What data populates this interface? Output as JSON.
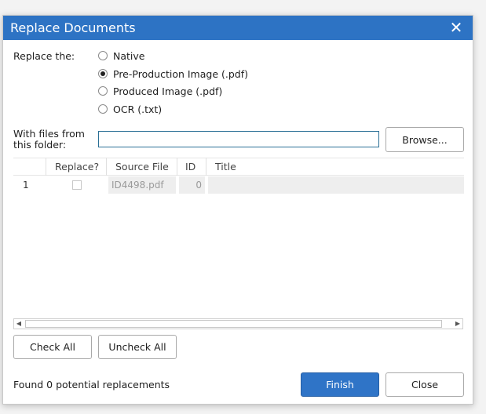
{
  "dialog": {
    "title": "Replace Documents",
    "close_glyph": "✕"
  },
  "replace": {
    "label": "Replace the:",
    "options": [
      {
        "label": "Native",
        "checked": false
      },
      {
        "label": "Pre-Production Image (.pdf)",
        "checked": true
      },
      {
        "label": "Produced Image (.pdf)",
        "checked": false
      },
      {
        "label": "OCR (.txt)",
        "checked": false
      }
    ]
  },
  "folder": {
    "label_line1": "With files from",
    "label_line2": "this folder:",
    "value": "",
    "browse_label": "Browse..."
  },
  "grid": {
    "columns": [
      "",
      "Replace?",
      "Source File",
      "ID",
      "Title"
    ],
    "rows": [
      {
        "num": "1",
        "replace": false,
        "source_file": "ID4498.pdf",
        "id": "0",
        "title": ""
      }
    ]
  },
  "scrollbar": {
    "left_arrow": "◀",
    "right_arrow": "▶"
  },
  "actions": {
    "check_all": "Check All",
    "uncheck_all": "Uncheck All",
    "finish": "Finish",
    "close": "Close"
  },
  "status": "Found 0 potential replacements",
  "colors": {
    "titlebar": "#2d73c4",
    "primary_button": "#2f74c7",
    "input_border": "#2a6f96"
  }
}
